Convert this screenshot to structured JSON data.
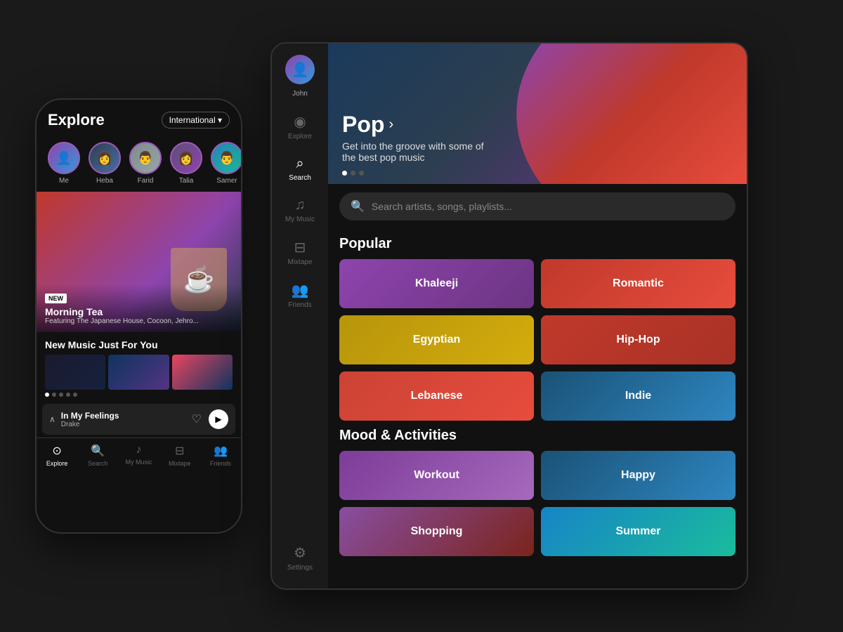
{
  "scene": {
    "background": "#1a1a1a"
  },
  "phone": {
    "title": "Explore",
    "dropdown": "International ▾",
    "avatars": [
      {
        "label": "Me",
        "emoji": "👤",
        "style": "me"
      },
      {
        "label": "Heba",
        "emoji": "👩",
        "style": "c1"
      },
      {
        "label": "Farid",
        "emoji": "👨",
        "style": "c2"
      },
      {
        "label": "Talia",
        "emoji": "👩",
        "style": "c3"
      },
      {
        "label": "Samer",
        "emoji": "👨",
        "style": "c4"
      }
    ],
    "featured": {
      "badge": "NEW",
      "title": "Morning Tea",
      "subtitle": "Featuring The Japanese House, Cocoon, Jehro..."
    },
    "new_music_section": "New Music Just For You",
    "now_playing": {
      "title": "In My Feelings",
      "artist": "Drake"
    },
    "nav": [
      {
        "label": "Explore",
        "icon": "⊙",
        "active": true
      },
      {
        "label": "Search",
        "icon": "🔍",
        "active": false
      },
      {
        "label": "My Music",
        "icon": "♪",
        "active": false
      },
      {
        "label": "Mixtape",
        "icon": "⊟",
        "active": false
      },
      {
        "label": "Friends",
        "icon": "👥",
        "active": false
      }
    ]
  },
  "tablet": {
    "sidebar": {
      "user_label": "John",
      "items": [
        {
          "label": "Explore",
          "icon": "◉",
          "active": false
        },
        {
          "label": "Search",
          "icon": "⌕",
          "active": true
        },
        {
          "label": "My Music",
          "icon": "♫",
          "active": false
        },
        {
          "label": "Mixtape",
          "icon": "⊟",
          "active": false
        },
        {
          "label": "Friends",
          "icon": "👥",
          "active": false
        },
        {
          "label": "Settings",
          "icon": "⚙",
          "active": false
        }
      ]
    },
    "hero": {
      "title": "Pop",
      "subtitle": "Get into the groove with some of the best pop music",
      "dots": 3,
      "active_dot": 0
    },
    "search": {
      "placeholder": "Search artists, songs, playlists..."
    },
    "popular_section": "Popular",
    "popular_genres": [
      {
        "label": "Khaleeji",
        "style": "gc-khaleeji"
      },
      {
        "label": "Romantic",
        "style": "gc-romantic"
      },
      {
        "label": "Egyptian",
        "style": "gc-egyptian"
      },
      {
        "label": "Hip-Hop",
        "style": "gc-hiphop"
      },
      {
        "label": "Lebanese",
        "style": "gc-lebanese"
      },
      {
        "label": "Indie",
        "style": "gc-indie"
      }
    ],
    "mood_section": "Mood & Activities",
    "mood_genres": [
      {
        "label": "Workout",
        "style": "gc-workout"
      },
      {
        "label": "Happy",
        "style": "gc-happy"
      },
      {
        "label": "Shopping",
        "style": "gc-shopping"
      },
      {
        "label": "Summer",
        "style": "gc-summer"
      }
    ]
  }
}
